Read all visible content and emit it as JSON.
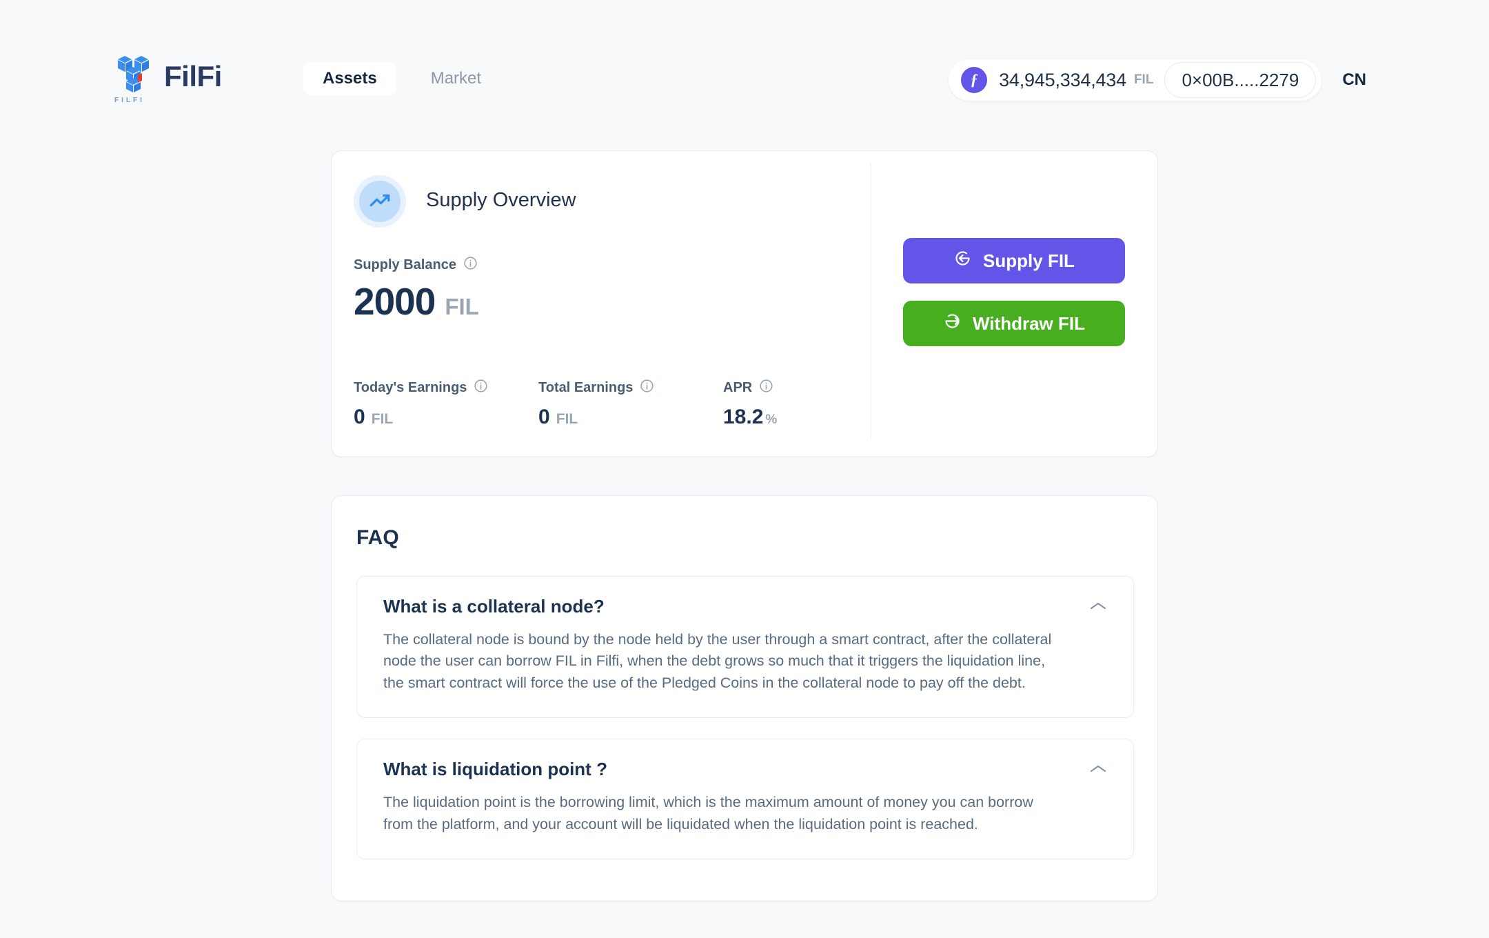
{
  "header": {
    "brand_name": "FilFi",
    "logo_caption": "FILFI",
    "nav": [
      {
        "label": "Assets",
        "active": true
      },
      {
        "label": "Market",
        "active": false
      }
    ],
    "wallet": {
      "amount": "34,945,334,434",
      "unit": "FIL",
      "token_glyph": "ƒ",
      "address": "0×00B.....2279"
    },
    "language": "CN"
  },
  "supply_card": {
    "title": "Supply Overview",
    "balance_label": "Supply Balance",
    "balance_value": "2000",
    "balance_unit": "FIL",
    "stats": [
      {
        "label": "Today's Earnings",
        "value": "0",
        "unit": "FIL"
      },
      {
        "label": "Total Earnings",
        "value": "0",
        "unit": "FIL"
      },
      {
        "label": "APR",
        "value": "18.2",
        "unit": "%"
      }
    ],
    "buttons": {
      "supply": "Supply FIL",
      "withdraw": "Withdraw FIL"
    }
  },
  "faq": {
    "title": "FAQ",
    "items": [
      {
        "question": "What is a collateral node?",
        "answer": "The collateral node is bound by the node held by the user through a smart contract, after the collateral node the user can borrow FIL in Filfi, when the debt grows so much that it triggers the liquidation line, the smart contract will force the use of the Pledged Coins in the collateral node to pay off the debt."
      },
      {
        "question": "What is liquidation point ?",
        "answer": "The liquidation point is the borrowing limit, which is the maximum amount of money you can borrow from the platform, and your account will be liquidated when the liquidation point is reached."
      }
    ]
  },
  "colors": {
    "page_background": "#f7f9fb",
    "brand_navy": "#2b3a63",
    "supply_button": "#6355e8",
    "withdraw_button": "#47ae1f",
    "accent_blue": "#2f8ef4"
  }
}
